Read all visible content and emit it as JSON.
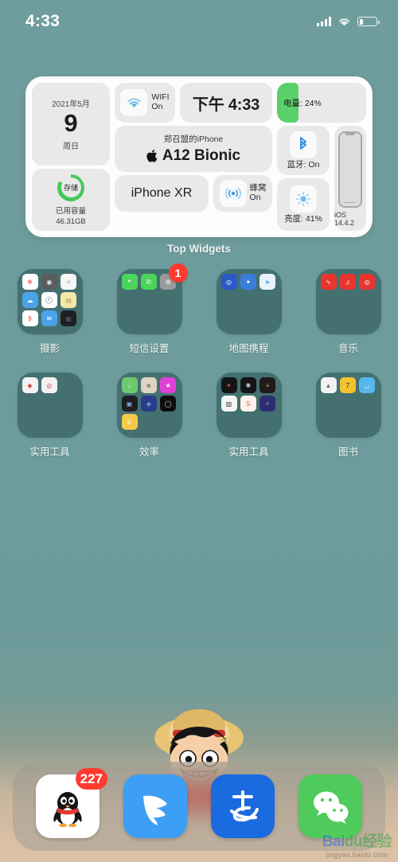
{
  "status_bar": {
    "time": "4:33",
    "signal_icon": "cellular-signal-icon",
    "wifi_icon": "wifi-icon",
    "battery_icon": "battery-low-icon",
    "battery_level_pct": 24
  },
  "widget": {
    "caption": "Top Widgets",
    "date": {
      "year_month": "2021年5月",
      "day": "9",
      "weekday": "周日"
    },
    "wifi": {
      "icon": "wifi-icon",
      "label_line1": "WIFI",
      "label_line2": "On"
    },
    "time": {
      "value": "下午 4:33"
    },
    "battery": {
      "label": "电量: 24%",
      "fill_pct": 24,
      "fill_color": "#59d06a"
    },
    "device": {
      "name": "郑召盟的iPhone",
      "chip": "A12 Bionic",
      "apple_icon": "apple-logo-icon"
    },
    "storage": {
      "ring_label": "存储",
      "title": "已用容量",
      "value": "46.31GB",
      "ring_color": "#45c85a"
    },
    "model": {
      "value": "iPhone XR"
    },
    "cellular": {
      "icon": "cellular-tower-icon",
      "label_line1": "蜂窝",
      "label_line2": "On"
    },
    "bluetooth": {
      "icon": "bluetooth-icon",
      "label": "蓝牙: On"
    },
    "brightness": {
      "icon": "brightness-sun-icon",
      "label": "亮度: 41%"
    },
    "ios": {
      "icon": "iphone-outline-icon",
      "version": "iOS 14.4.2"
    }
  },
  "folders": [
    {
      "name": "摄影",
      "badge": null,
      "icons": [
        {
          "name": "photos-icon",
          "color": "#ffffff",
          "glyph": "❋",
          "fg": "#f25c5c"
        },
        {
          "name": "camera-icon",
          "color": "#5c5c5e",
          "glyph": "◉",
          "fg": "#e8e8e8"
        },
        {
          "name": "reminders-icon",
          "color": "#f6f6f6",
          "glyph": "≡",
          "fg": "#9a9a9a"
        },
        {
          "name": "weather-icon",
          "color": "#4aa3e8",
          "glyph": "☁",
          "fg": "#ffffff"
        },
        {
          "name": "clock-icon",
          "color": "#ffffff",
          "glyph": "🕙",
          "fg": "#111111"
        },
        {
          "name": "notes-icon",
          "color": "#f3e7a8",
          "glyph": "▤",
          "fg": "#b9a349"
        },
        {
          "name": "calendar-icon",
          "color": "#ffffff",
          "glyph": "9",
          "fg": "#e23b2e"
        },
        {
          "name": "mail-icon",
          "color": "#4aa3e8",
          "glyph": "✉",
          "fg": "#ffffff"
        },
        {
          "name": "dark-photo-app-icon",
          "color": "#1c2024",
          "glyph": "▦",
          "fg": "#555a5e"
        }
      ]
    },
    {
      "name": "短信设置",
      "badge": "1",
      "icons": [
        {
          "name": "messages-icon",
          "color": "#4cd55c",
          "glyph": "❝",
          "fg": "#ffffff"
        },
        {
          "name": "phone-icon",
          "color": "#4cd55c",
          "glyph": "✆",
          "fg": "#ffffff"
        },
        {
          "name": "settings-icon",
          "color": "#9a9a9c",
          "glyph": "⚙",
          "fg": "#ffffff"
        }
      ]
    },
    {
      "name": "地图携程",
      "badge": null,
      "icons": [
        {
          "name": "amap-icon",
          "color": "#2c59c8",
          "glyph": "◎",
          "fg": "#ffffff"
        },
        {
          "name": "baidu-map-icon",
          "color": "#3b7ddd",
          "glyph": "✦",
          "fg": "#ffffff"
        },
        {
          "name": "ctrip-icon",
          "color": "#e8f3fd",
          "glyph": "➤",
          "fg": "#3b9ae8"
        }
      ]
    },
    {
      "name": "音乐",
      "badge": null,
      "icons": [
        {
          "name": "netease-music-icon",
          "color": "#e8352e",
          "glyph": "∿",
          "fg": "#ffffff"
        },
        {
          "name": "apple-music-icon",
          "color": "#e8352e",
          "glyph": "♫",
          "fg": "#ffffff"
        },
        {
          "name": "qq-music-icon",
          "color": "#e8352e",
          "glyph": "◎",
          "fg": "#ffffff"
        }
      ]
    },
    {
      "name": "实用工具",
      "badge": null,
      "icons": [
        {
          "name": "tool-app-red-icon",
          "color": "#f2f2f2",
          "glyph": "◆",
          "fg": "#e04b4b"
        },
        {
          "name": "tool-app-target-icon",
          "color": "#f2f2f2",
          "glyph": "◎",
          "fg": "#d04545"
        }
      ]
    },
    {
      "name": "效率",
      "badge": null,
      "icons": [
        {
          "name": "green-utility-icon",
          "color": "#6ec96e",
          "glyph": "↓",
          "fg": "#ffffff"
        },
        {
          "name": "beige-utility-icon",
          "color": "#ddd4c4",
          "glyph": "☻",
          "fg": "#8b8272"
        },
        {
          "name": "magenta-star-icon",
          "color": "#e040d8",
          "glyph": "★",
          "fg": "#ffffff"
        },
        {
          "name": "dark-tool-icon",
          "color": "#1e1e22",
          "glyph": "▣",
          "fg": "#7aa6d8"
        },
        {
          "name": "layers-icon",
          "color": "#2a3b8c",
          "glyph": "◈",
          "fg": "#7fb2ee"
        },
        {
          "name": "black-ring-icon",
          "color": "#0d0d0f",
          "glyph": "◯",
          "fg": "#e8e8e8"
        },
        {
          "name": "idea-bulb-icon",
          "color": "#f7c948",
          "glyph": "♕",
          "fg": "#ffffff"
        }
      ]
    },
    {
      "name": "实用工具",
      "badge": null,
      "icons": [
        {
          "name": "dark-analytics-icon",
          "color": "#151518",
          "glyph": "✦",
          "fg": "#e05050"
        },
        {
          "name": "dark-spiral-icon",
          "color": "#151518",
          "glyph": "✺",
          "fg": "#cfcfcf"
        },
        {
          "name": "dark-lines-icon",
          "color": "#201a18",
          "glyph": "≡",
          "fg": "#c49a5a"
        },
        {
          "name": "calc-icon",
          "color": "#f4f4f4",
          "glyph": "▥",
          "fg": "#333333"
        },
        {
          "name": "scan-icon",
          "color": "#fdf2ec",
          "glyph": "S",
          "fg": "#e8643c"
        },
        {
          "name": "galaxy-icon",
          "color": "#2b2f72",
          "glyph": "✧",
          "fg": "#d88fe8"
        }
      ]
    },
    {
      "name": "图书",
      "badge": null,
      "icons": [
        {
          "name": "books-white-icon",
          "color": "#f2f2f2",
          "glyph": "▲",
          "fg": "#6a6a6c"
        },
        {
          "name": "books-yellow-icon",
          "color": "#f2c230",
          "glyph": "7",
          "fg": "#1c1c1e"
        },
        {
          "name": "reader-blue-icon",
          "color": "#58b6ee",
          "glyph": "◡",
          "fg": "#ffffff"
        }
      ]
    }
  ],
  "dock": [
    {
      "name": "QQ",
      "icon": "qq-penguin-icon",
      "color": "#ffffff",
      "badge": "227"
    },
    {
      "name": "钉钉",
      "icon": "dingtalk-icon",
      "color": "#3d9ef5",
      "badge": null
    },
    {
      "name": "支付宝",
      "icon": "alipay-icon",
      "color": "#1a6ae0",
      "badge": null
    },
    {
      "name": "微信",
      "icon": "wechat-icon",
      "color": "#4ecb5a",
      "badge": null
    }
  ],
  "watermark": {
    "line1_a": "Bai",
    "line1_b": "du",
    "line1_c": "经验",
    "line2": "jingyan.baidu.com"
  }
}
